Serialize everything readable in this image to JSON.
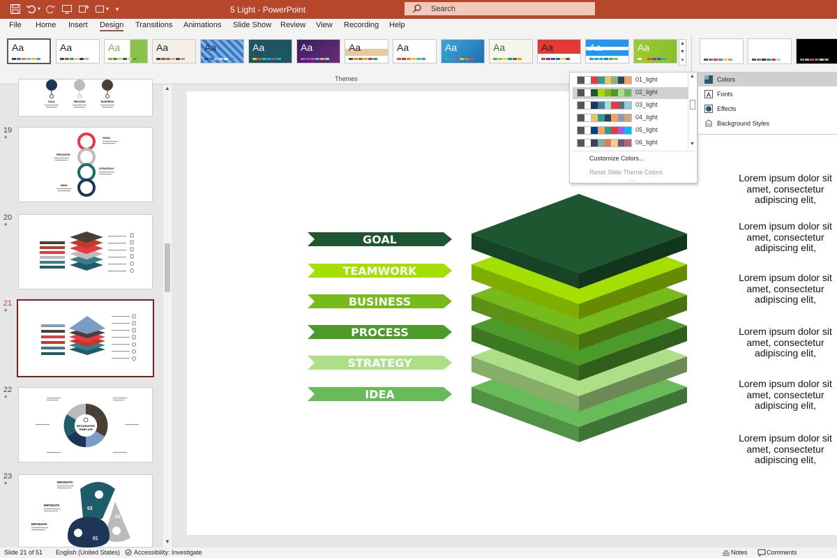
{
  "titlebar": {
    "doc_title": "5 Light  -  PowerPoint",
    "search_placeholder": "Search"
  },
  "menu": [
    "File",
    "Home",
    "Insert",
    "Design",
    "Transitions",
    "Animations",
    "Slide Show",
    "Review",
    "View",
    "Recording",
    "Help"
  ],
  "active_menu": "Design",
  "ribbon": {
    "aa": "Aa",
    "themes_label": "Themes"
  },
  "slides": [
    {
      "number": "19",
      "star": "*"
    },
    {
      "number": "20",
      "star": "*"
    },
    {
      "number": "21",
      "star": "*"
    },
    {
      "number": "22",
      "star": "*"
    },
    {
      "number": "23",
      "star": "*"
    }
  ],
  "slide": {
    "labels": [
      "GOAL",
      "TEAMWORK",
      "BUSINESS",
      "PROCESS",
      "STRATEGY",
      "IDEA"
    ],
    "label_colors": [
      "#1e5631",
      "#a4de02",
      "#76ba1b",
      "#4c9a2a",
      "#acdf87",
      "#68bb59"
    ],
    "lorem": "Lorem ipsum dolor sit\namet, consectetur\nadipiscing elit,"
  },
  "thumb_text": {
    "goal": "GOAL",
    "process": "PROCESS",
    "business": "BUSINESS",
    "strategy": "STRATEGY",
    "idea": "IDEA",
    "infographic": "INFOGRAPHIC",
    "template": "TEMPLATE",
    "infodata": "INFODATA",
    "infodata_lc": "INFODATA",
    "n01": "01",
    "n02": "02",
    "n03": "03"
  },
  "color_schemes": [
    {
      "label": "01_light",
      "colors": [
        "#555555",
        "#ffffff",
        "#e63946",
        "#2a9d8f",
        "#e9c46a",
        "#8ab17d",
        "#264653",
        "#f4a261"
      ]
    },
    {
      "label": "02_light",
      "colors": [
        "#555555",
        "#ffffff",
        "#1e5631",
        "#a4de02",
        "#76ba1b",
        "#4c9a2a",
        "#acdf87",
        "#68bb59"
      ]
    },
    {
      "label": "03_light",
      "colors": [
        "#555555",
        "#ffffff",
        "#1d3557",
        "#457b9d",
        "#a8dadc",
        "#e63946",
        "#6d6875",
        "#8ecae6"
      ]
    },
    {
      "label": "04_light",
      "colors": [
        "#555555",
        "#ffffff",
        "#e9c46a",
        "#2a9d8f",
        "#264653",
        "#f4a261",
        "#8d99ae",
        "#d4a373"
      ]
    },
    {
      "label": "05_light",
      "colors": [
        "#555555",
        "#ffffff",
        "#023e8a",
        "#f4a261",
        "#2a9d8f",
        "#e63946",
        "#9b5de5",
        "#00bbf9"
      ]
    },
    {
      "label": "06_light",
      "colors": [
        "#555555",
        "#ffffff",
        "#3d405b",
        "#81b29a",
        "#e07a5f",
        "#f2cc8f",
        "#6d597a",
        "#b56576"
      ]
    }
  ],
  "selected_scheme": "02_light",
  "dropdown_links": {
    "customize": "Customize Colors...",
    "reset": "Reset Slide Theme Colors",
    "dots": "....."
  },
  "flyout": [
    "Colors",
    "Fonts",
    "Effects",
    "Background Styles"
  ],
  "status": {
    "slide": "Slide 21 of 51",
    "language": "English (United States)",
    "accessibility": "Accessibility: Investigate",
    "notes": "Notes",
    "comments": "Comments"
  }
}
